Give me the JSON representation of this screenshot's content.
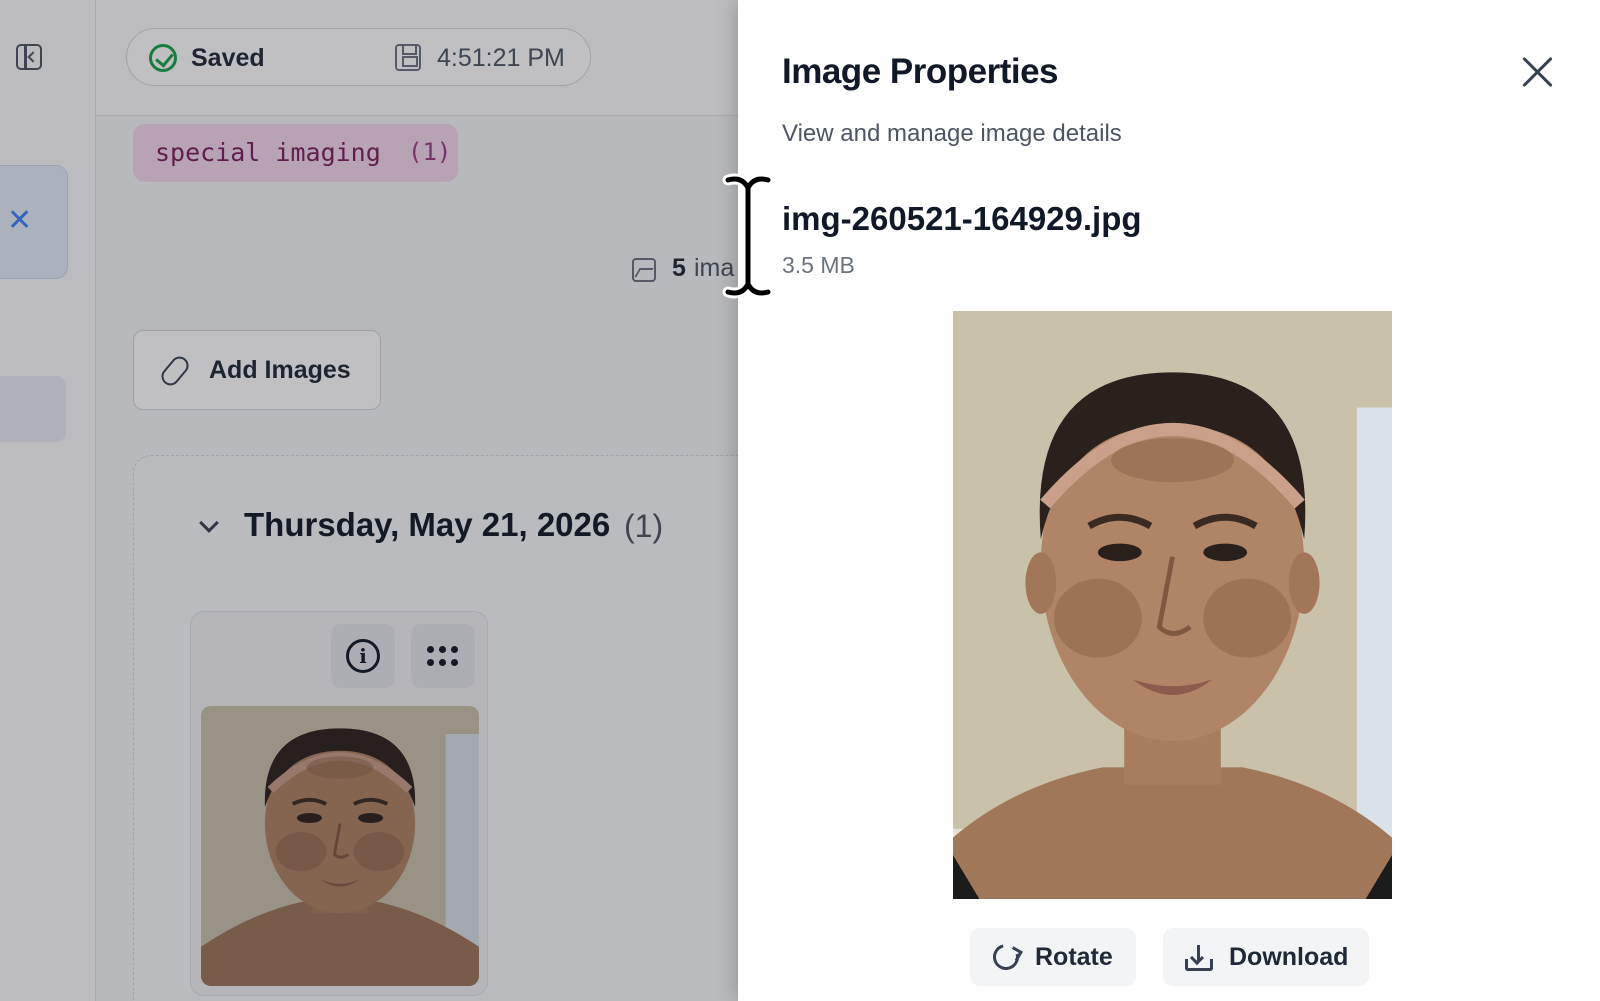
{
  "topbar": {
    "saved_label": "Saved",
    "saved_time": "4:51:21 PM"
  },
  "tag": {
    "label": "special imaging",
    "count": "(1)"
  },
  "images_summary": {
    "count": "5",
    "suffix": "ima"
  },
  "toolbar": {
    "add_images_label": "Add Images"
  },
  "group": {
    "date_title": "Thursday, May 21, 2026",
    "count": "(1)"
  },
  "panel": {
    "title": "Image Properties",
    "subtitle": "View and manage image details",
    "file_name": "img-260521-164929.jpg",
    "file_size": "3.5 MB",
    "rotate_label": "Rotate",
    "download_label": "Download"
  },
  "colors": {
    "saved_check": "#16a34a",
    "tag_bg": "#f3d7ec",
    "tag_text": "#7a1f5e",
    "accent_blue": "#3b82f6"
  }
}
